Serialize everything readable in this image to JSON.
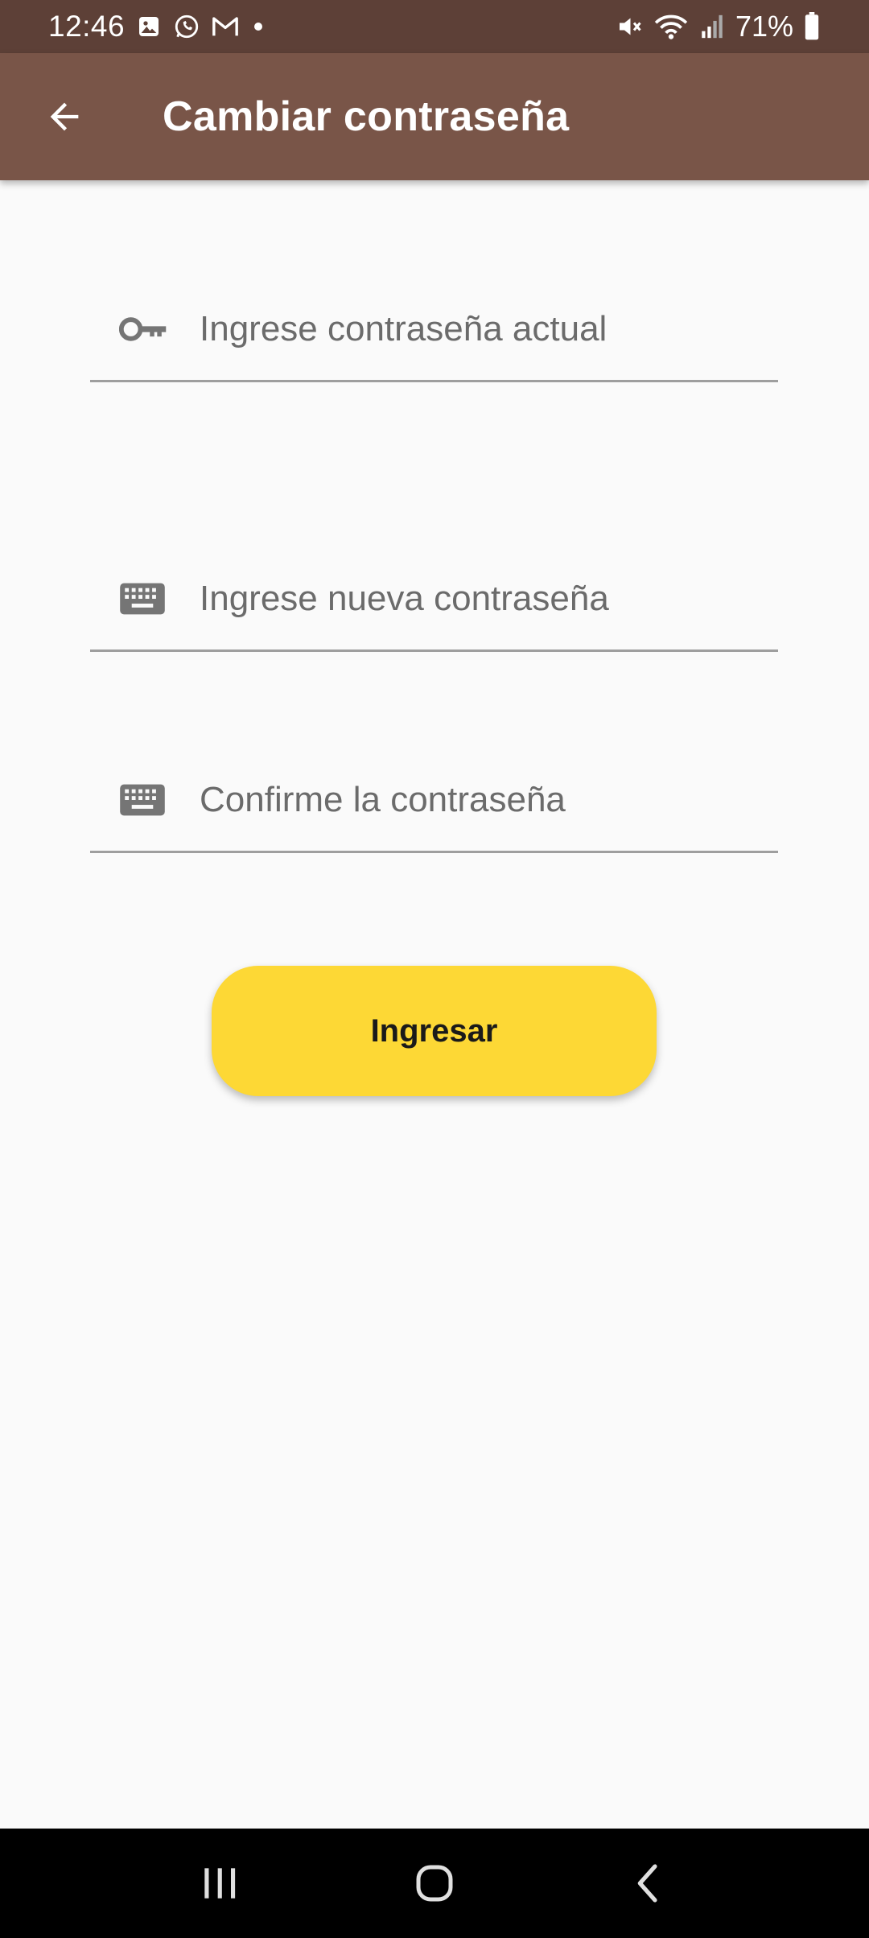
{
  "status_bar": {
    "time": "12:46",
    "battery": "71%",
    "notification_icons": [
      "gallery-icon",
      "whatsapp-icon",
      "gmail-icon",
      "dot-icon"
    ],
    "system_icons": [
      "mute-icon",
      "wifi-icon",
      "signal-icon",
      "battery-icon"
    ]
  },
  "app_bar": {
    "title": "Cambiar contraseña",
    "back_icon": "arrow-left-icon"
  },
  "form": {
    "current_password": {
      "placeholder": "Ingrese contraseña actual",
      "value": "",
      "icon": "key-icon"
    },
    "new_password": {
      "placeholder": "Ingrese nueva contraseña",
      "value": "",
      "icon": "keyboard-icon"
    },
    "confirm_password": {
      "placeholder": "Confirme la contraseña",
      "value": "",
      "icon": "keyboard-icon"
    },
    "submit_label": "Ingresar"
  },
  "nav_bar": {
    "buttons": [
      "recents-icon",
      "home-icon",
      "back-icon"
    ]
  },
  "colors": {
    "status_bar": "#5d4037",
    "app_bar": "#795548",
    "background": "#fafafa",
    "button": "#fdd835",
    "icon_gray": "#757575",
    "underline": "#9e9e9e"
  }
}
